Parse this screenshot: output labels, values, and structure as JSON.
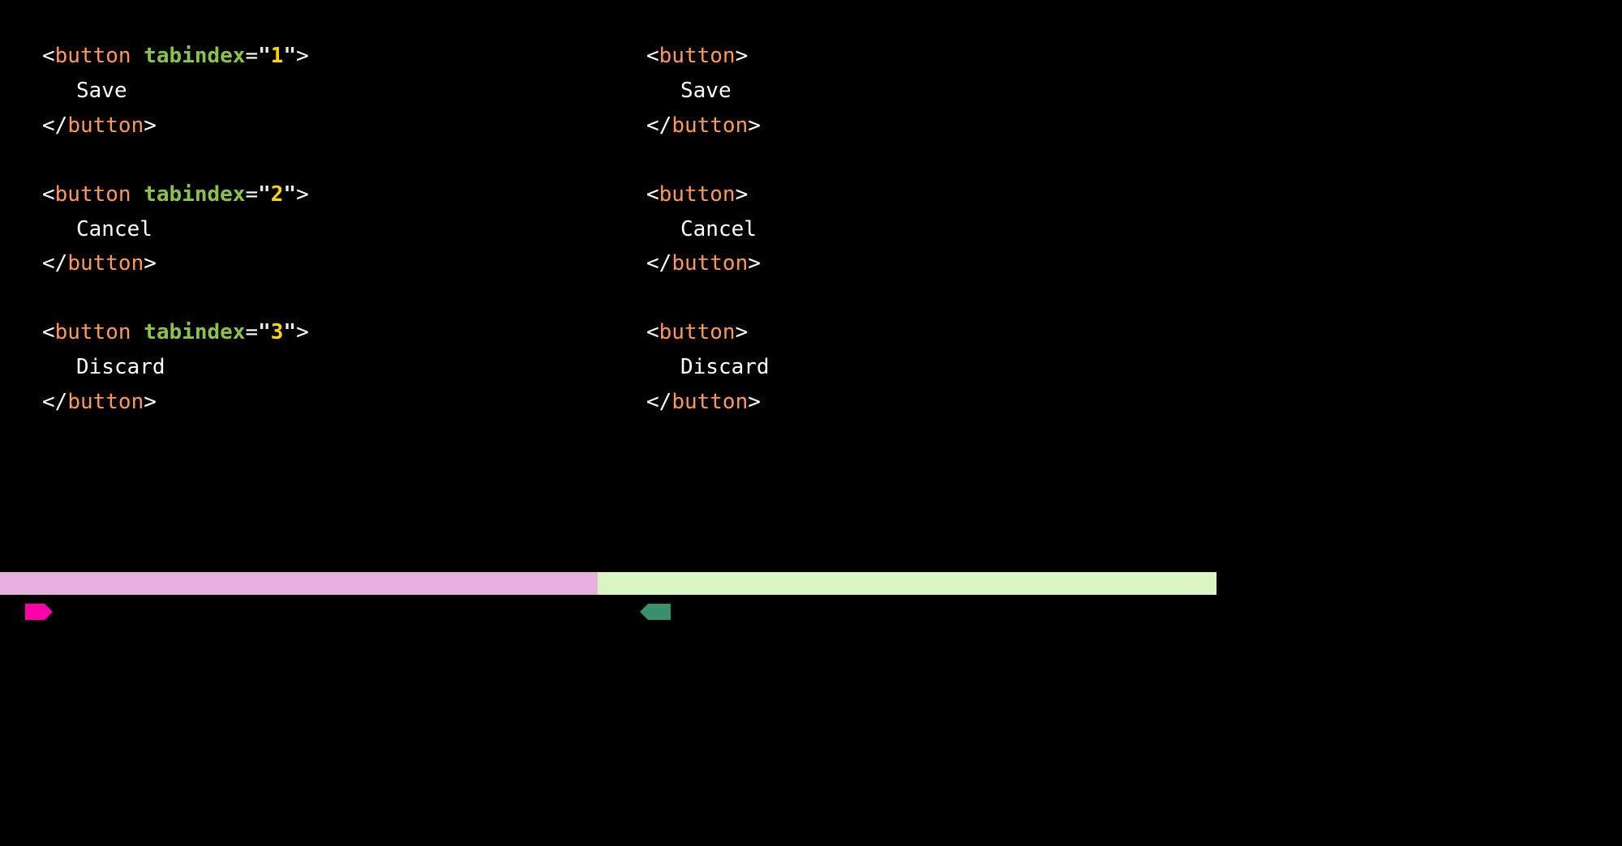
{
  "left": {
    "blocks": [
      {
        "tag": "button",
        "attr_name": "tabindex",
        "attr_value": "1",
        "text": "Save"
      },
      {
        "tag": "button",
        "attr_name": "tabindex",
        "attr_value": "2",
        "text": "Cancel"
      },
      {
        "tag": "button",
        "attr_name": "tabindex",
        "attr_value": "3",
        "text": "Discard"
      }
    ]
  },
  "right": {
    "blocks": [
      {
        "tag": "button",
        "text": "Save"
      },
      {
        "tag": "button",
        "text": "Cancel"
      },
      {
        "tag": "button",
        "text": "Discard"
      }
    ]
  },
  "punct": {
    "lt": "<",
    "gt": ">",
    "slash": "/",
    "eq": "=",
    "quote": "\"",
    "space": " "
  }
}
